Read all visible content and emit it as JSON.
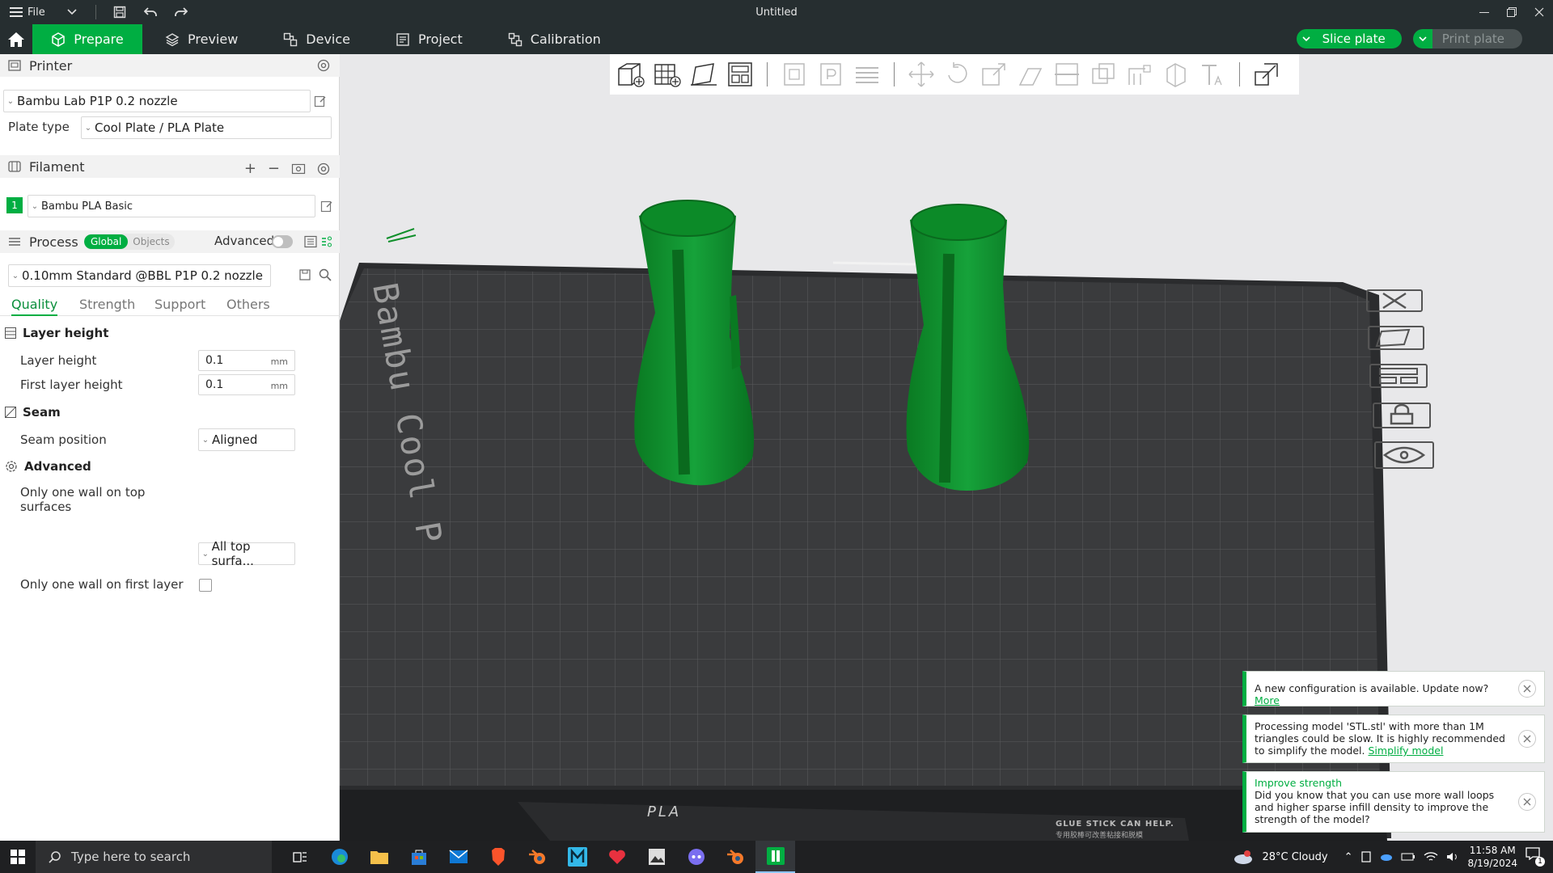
{
  "titlebar": {
    "file_label": "File",
    "title": "Untitled"
  },
  "nav": {
    "tabs": [
      {
        "label": "Prepare"
      },
      {
        "label": "Preview"
      },
      {
        "label": "Device"
      },
      {
        "label": "Project"
      },
      {
        "label": "Calibration"
      }
    ],
    "slice_label": "Slice plate",
    "print_label": "Print plate"
  },
  "sidebar": {
    "printer": {
      "header": "Printer",
      "selected": "Bambu Lab P1P 0.2 nozzle",
      "plate_type_label": "Plate type",
      "plate_type_value": "Cool Plate / PLA Plate"
    },
    "filament": {
      "header": "Filament",
      "items": [
        {
          "num": "1",
          "name": "Bambu PLA Basic",
          "color": "#00ae42"
        }
      ]
    },
    "process": {
      "header": "Process",
      "toggle_on": "Global",
      "toggle_off": "Objects",
      "advanced_label": "Advanced",
      "preset": "0.10mm Standard @BBL P1P 0.2 nozzle",
      "tabs": [
        "Quality",
        "Strength",
        "Support",
        "Others"
      ],
      "groups": {
        "layer_height": {
          "title": "Layer height",
          "layer_height_label": "Layer height",
          "layer_height_value": "0.1",
          "first_layer_label": "First layer height",
          "first_layer_value": "0.1",
          "unit": "mm"
        },
        "seam": {
          "title": "Seam",
          "position_label": "Seam position",
          "position_value": "Aligned"
        },
        "advanced": {
          "title": "Advanced",
          "top_wall_label": "Only one wall on top surfaces",
          "top_wall_value": "All top surfa...",
          "first_layer_wall_label": "Only one wall on first layer",
          "first_layer_wall_checked": false
        }
      }
    }
  },
  "viewport": {
    "plate_brand_text": "Bambu Cool P",
    "plate_bottom_text": "PLA",
    "glue_text": "GLUE STICK CAN HELP.",
    "glue_text_cn": "专用胶棒可改善粘接和脱模",
    "model_color": "#0f8f2a"
  },
  "notifications": [
    {
      "text": "A new configuration is available. Update now?",
      "link": "More"
    },
    {
      "text": "Processing model 'STL.stl' with more than 1M triangles could be slow. It is highly recommended to simplify the model.",
      "link": "Simplify model"
    },
    {
      "title": "Improve strength",
      "text": "Did you know that you can use more wall loops and higher sparse infill density to improve the strength of the model?"
    }
  ],
  "taskbar": {
    "search_placeholder": "Type here to search",
    "weather": "28°C  Cloudy",
    "time": "11:58 AM",
    "date": "8/19/2024",
    "notif_count": "1"
  }
}
